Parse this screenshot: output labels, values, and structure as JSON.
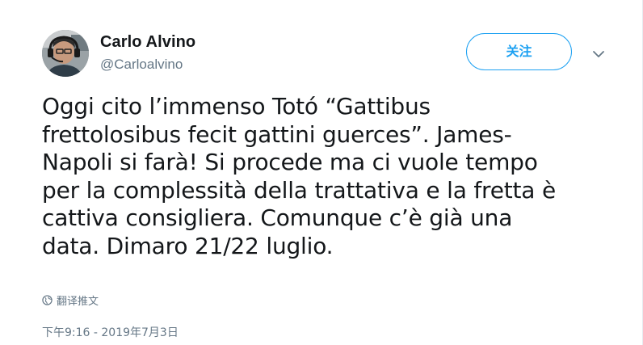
{
  "author": {
    "name": "Carlo Alvino",
    "handle": "@Carloalvino"
  },
  "follow_label": "关注",
  "tweet": {
    "lines": [
      "Oggi cito l’immenso Totó “Gattibus",
      "frettolosibus fecit gattini guerces”. James-",
      "Napoli si farà! Si procede ma ci vuole tempo",
      "per la complessità della trattativa e la fretta è",
      "cattiva consigliera. Comunque c’è già una",
      "data. Dimaro 21/22 luglio."
    ]
  },
  "translate_label": "翻译推文",
  "timestamp": "下午9:16 - 2019年7月3日",
  "icons": {
    "avatar": "avatar-photo",
    "caret": "chevron-down-icon",
    "globe": "globe-icon"
  },
  "colors": {
    "accent": "#1da1f2",
    "text": "#14171a",
    "secondary": "#657786"
  }
}
